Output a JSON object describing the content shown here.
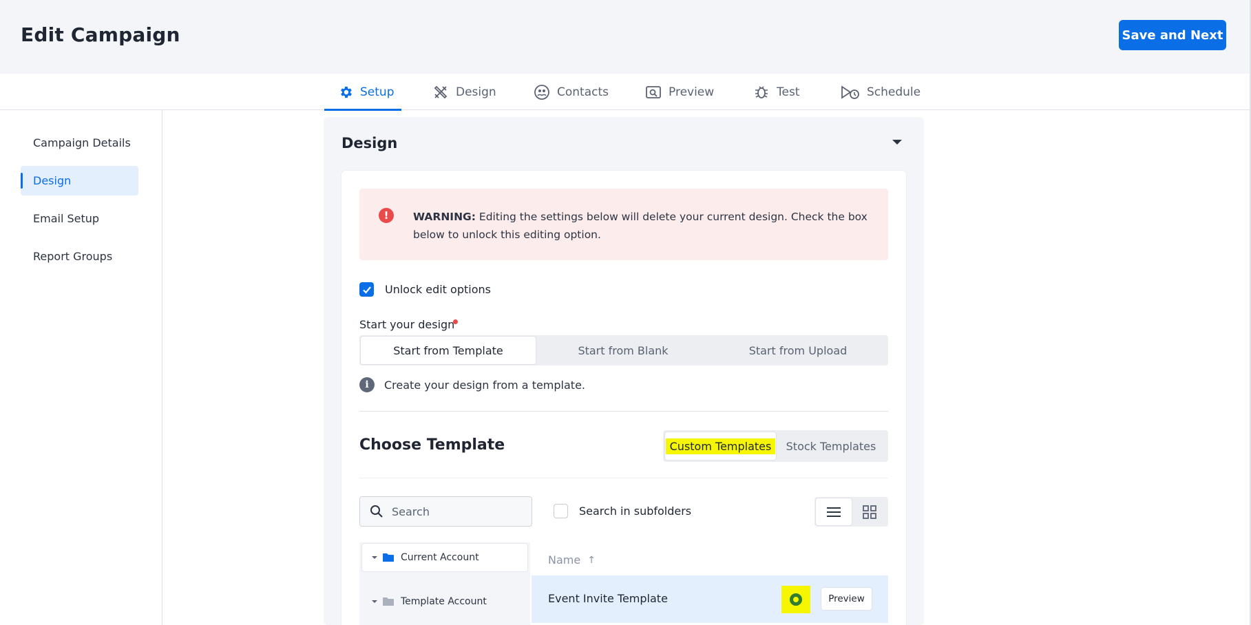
{
  "header": {
    "title": "Edit Campaign",
    "save_label": "Save and Next"
  },
  "tabs": [
    {
      "label": "Setup",
      "icon": "gear-icon",
      "active": true
    },
    {
      "label": "Design",
      "icon": "design-tools-icon"
    },
    {
      "label": "Contacts",
      "icon": "contacts-icon"
    },
    {
      "label": "Preview",
      "icon": "preview-icon"
    },
    {
      "label": "Test",
      "icon": "bug-icon"
    },
    {
      "label": "Schedule",
      "icon": "schedule-icon"
    }
  ],
  "sidebar": {
    "items": [
      {
        "label": "Campaign Details"
      },
      {
        "label": "Design",
        "active": true
      },
      {
        "label": "Email Setup"
      },
      {
        "label": "Report Groups"
      }
    ]
  },
  "design_panel": {
    "title": "Design",
    "warning": {
      "bold": "WARNING:",
      "text": " Editing the settings below will delete your current design. Check the box below to unlock this editing option."
    },
    "unlock_label": "Unlock edit options",
    "unlock_checked": true,
    "start_label": "Start your design",
    "start_options": [
      "Start from Template",
      "Start from Blank",
      "Start from Upload"
    ],
    "start_selected": "Start from Template",
    "info_text": "Create your design from a template.",
    "choose_title": "Choose Template",
    "template_types": [
      "Custom Templates",
      "Stock Templates"
    ],
    "template_type_selected": "Custom Templates",
    "search_placeholder": "Search",
    "subfolders_label": "Search in subfolders",
    "subfolders_checked": false,
    "view_mode": "list",
    "folders": [
      {
        "label": "Current Account",
        "active": true
      },
      {
        "label": "Template Account"
      }
    ],
    "column_name": "Name",
    "sort_arrow": "↑",
    "rows": [
      {
        "name": "Event Invite Template",
        "preview_label": "Preview",
        "selected": true
      }
    ]
  },
  "colors": {
    "accent": "#0a6ee6",
    "highlight": "#f6f600",
    "warning_bg": "#fdecec",
    "warning_icon": "#e94b4b"
  }
}
